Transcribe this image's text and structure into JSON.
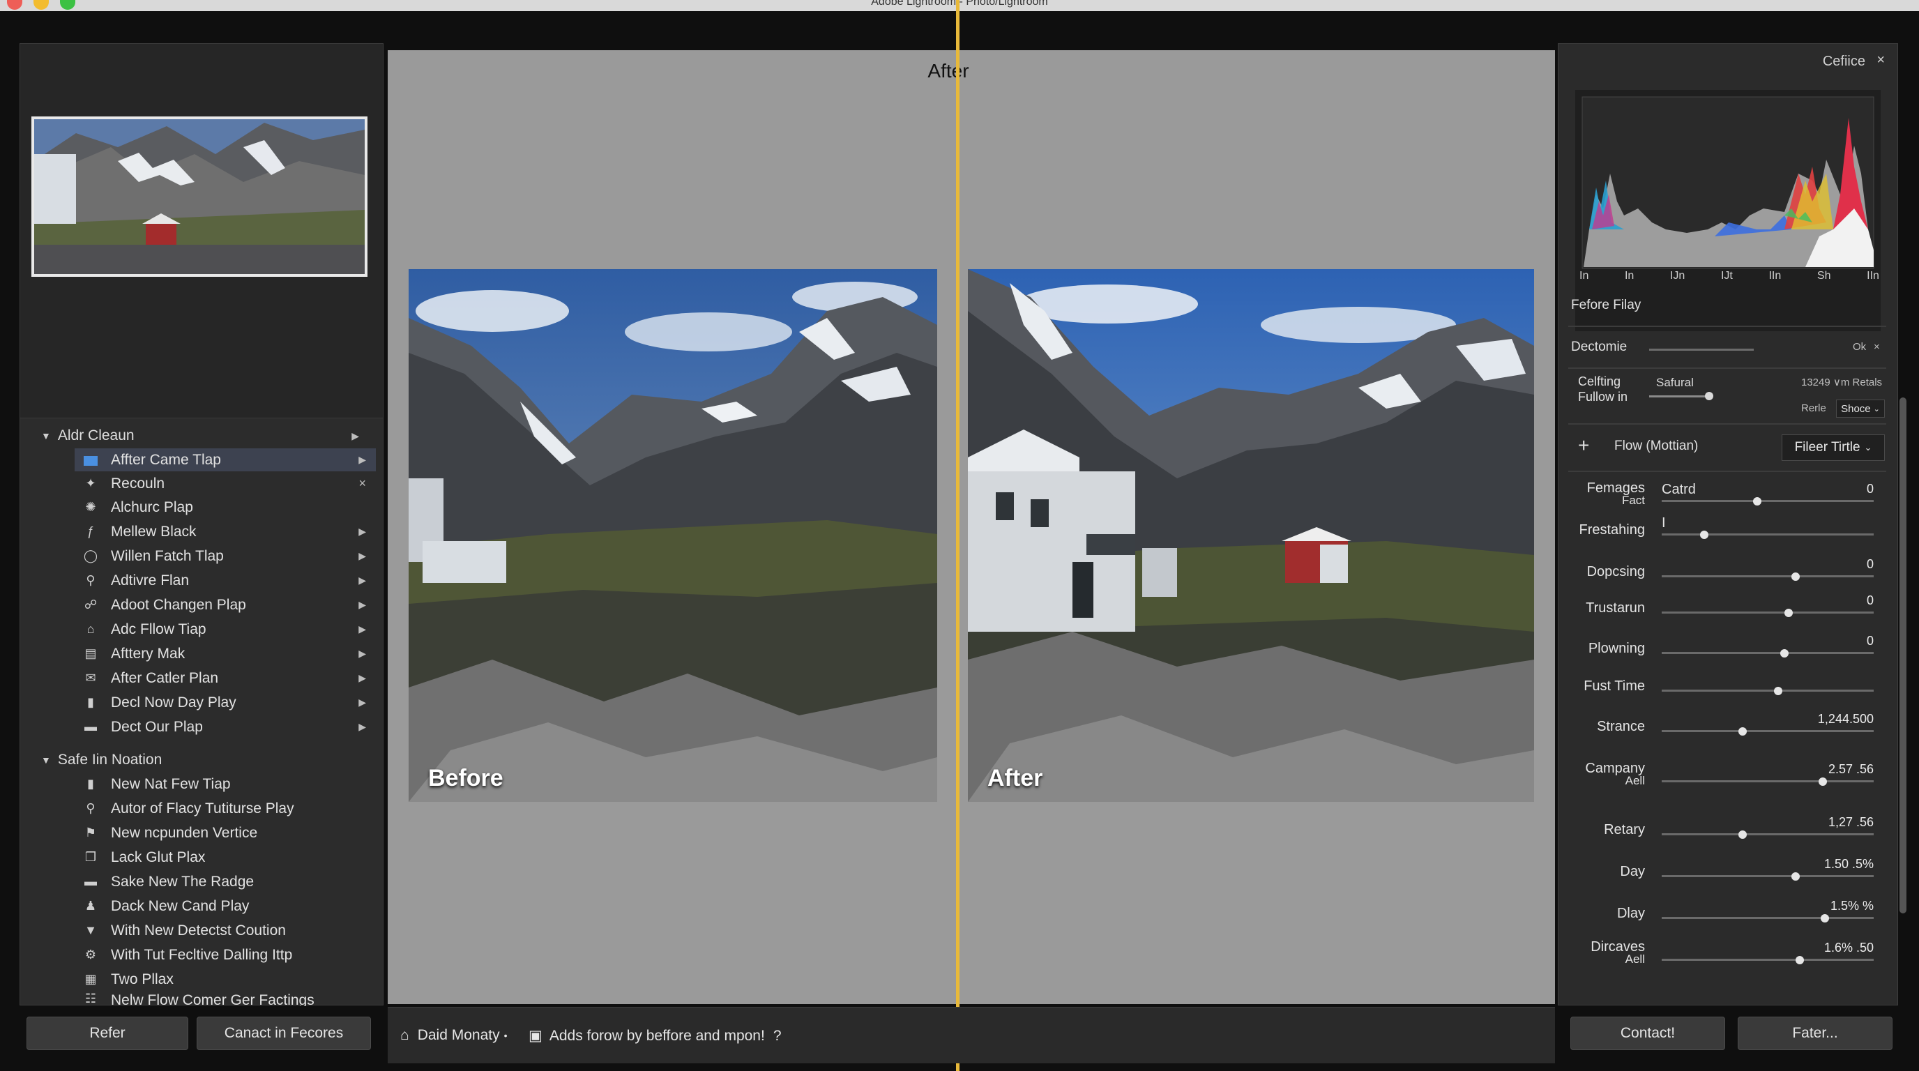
{
  "window": {
    "title": "Adobe Lightroom - Photo/Lightroom"
  },
  "left_panel": {
    "groups": [
      {
        "title": "Aldr Cleaun",
        "items": [
          {
            "label": "Affter Came Tlap",
            "icon": "folder-icon",
            "trail": "arrow"
          },
          {
            "label": "Recouln",
            "icon": "pin-icon",
            "trail": "close"
          },
          {
            "label": "Alchurc Plap",
            "icon": "gear-icon",
            "trail": ""
          },
          {
            "label": "Mellew Black",
            "icon": "f-icon",
            "trail": "arrow"
          },
          {
            "label": "Willen Fatch Tlap",
            "icon": "circle-icon",
            "trail": "arrow"
          },
          {
            "label": "Adtivre Flan",
            "icon": "person-icon",
            "trail": "arrow"
          },
          {
            "label": "Adoot Changen Plap",
            "icon": "people-icon",
            "trail": "arrow"
          },
          {
            "label": "Adc Fllow Tiap",
            "icon": "home-icon",
            "trail": "arrow"
          },
          {
            "label": "Afttery Mak",
            "icon": "document-icon",
            "trail": "arrow"
          },
          {
            "label": "After Catler Plan",
            "icon": "mail-icon",
            "trail": "arrow"
          },
          {
            "label": "Decl Now Day Play",
            "icon": "file-icon",
            "trail": "arrow"
          },
          {
            "label": "Dect Our Plap",
            "icon": "folder-icon",
            "trail": "arrow"
          }
        ]
      },
      {
        "title": "Safe Iin Noation",
        "items": [
          {
            "label": "New Nat Few Tiap",
            "icon": "file-icon"
          },
          {
            "label": "Autor of Flacy Tutiturse Play",
            "icon": "person-icon"
          },
          {
            "label": "New ncpunden Vertice",
            "icon": "flag-icon"
          },
          {
            "label": "Lack Glut Plax",
            "icon": "copy-icon"
          },
          {
            "label": "Sake New The Radge",
            "icon": "folder-icon"
          },
          {
            "label": "Dack New Cand Play",
            "icon": "person-icon"
          },
          {
            "label": "With New Detectst Coution",
            "icon": "bucket-icon"
          },
          {
            "label": "With Tut Fecltive Dalling Ittp",
            "icon": "gear-icon"
          },
          {
            "label": "Two Pllax",
            "icon": "grid-icon"
          },
          {
            "label": "Nelw Flow Comer Ger Factings",
            "icon": "list-icon"
          }
        ]
      }
    ],
    "buttons": {
      "refer": "Refer",
      "cancel": "Canact in Fecores"
    }
  },
  "center": {
    "top_label": "After",
    "before_label": "Before",
    "after_label": "After",
    "status_user": "Daid Monaty",
    "status_sep": "•",
    "status_text": "Adds forow by beffore and mpon!",
    "status_help": "?"
  },
  "right_panel": {
    "title": "Cefiice",
    "histogram": {
      "ticks": [
        "In",
        "In",
        "IJn",
        "IJt",
        "IIn",
        "Sh",
        "IIn"
      ],
      "label": "Fefore Filay"
    },
    "decomie": {
      "label": "Dectomie",
      "ok": "Ok"
    },
    "calibration": {
      "label_line1": "Celfting",
      "label_line2": "Fullow in",
      "slider_name": "Safural",
      "readout": "13249 ∨m Retals",
      "dropdown_label": "Rerle",
      "dropdown_value": "Shoce"
    },
    "flow": {
      "label": "Flow (Mottian)",
      "dropdown": "Fileer Tirtle"
    },
    "sliders": [
      {
        "label": "Femages\nFact",
        "sub": "Catrd",
        "value": "0",
        "pos": 0.45
      },
      {
        "label": "Frestahing",
        "sub": "I",
        "value": "",
        "pos": 0.2
      },
      {
        "label": "Dopcsing",
        "sub": "",
        "value": "0",
        "pos": 0.63
      },
      {
        "label": "Trustarun",
        "sub": "",
        "value": "0",
        "pos": 0.6
      },
      {
        "label": "Plowning",
        "sub": "",
        "value": "0",
        "pos": 0.58
      },
      {
        "label": "Fust Time",
        "sub": "",
        "value": "",
        "pos": 0.55
      },
      {
        "label": "Strance",
        "sub": "",
        "value": "1,244.500",
        "pos": 0.38
      },
      {
        "label": "Campany\nAell",
        "sub": "",
        "value": "2.57 .56",
        "pos": 0.76
      },
      {
        "label": "Retary",
        "sub": "",
        "value": "1,27 .56",
        "pos": 0.38
      },
      {
        "label": "Day",
        "sub": "",
        "value": "1.50 .5%",
        "pos": 0.63
      },
      {
        "label": "Dlay",
        "sub": "",
        "value": "1.5% %",
        "pos": 0.77
      },
      {
        "label": "Dircaves\nAell",
        "sub": "",
        "value": "1.6% .50",
        "pos": 0.65
      }
    ],
    "buttons": {
      "contact": "Contact!",
      "fater": "Fater..."
    }
  }
}
